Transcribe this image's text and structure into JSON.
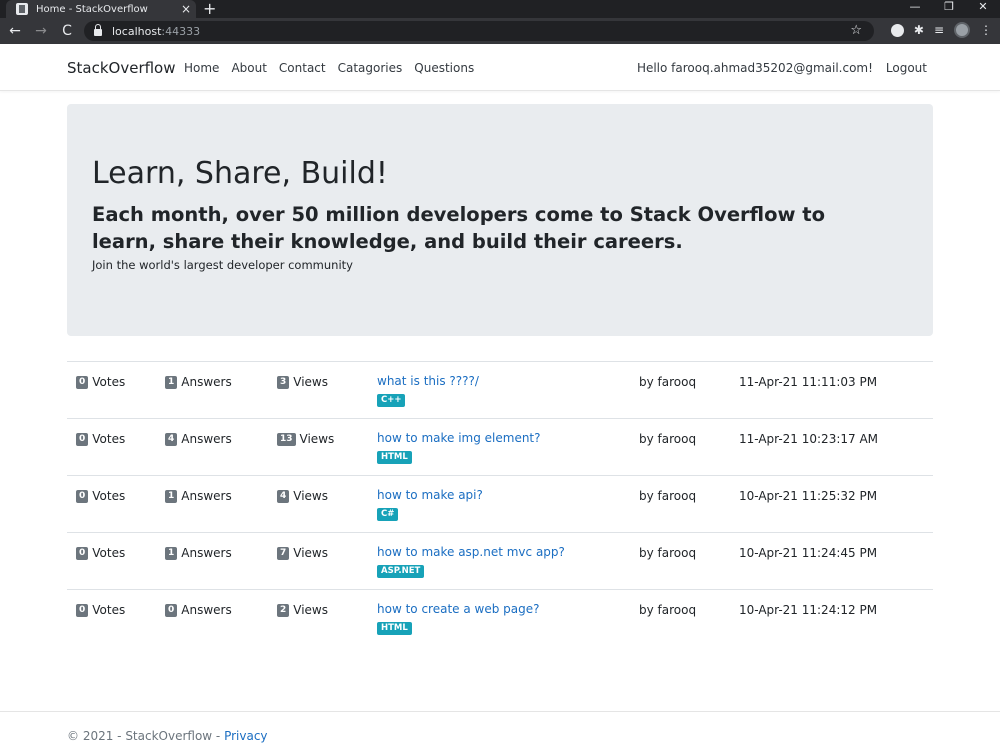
{
  "browser": {
    "tab_title": "Home - StackOverflow",
    "tab_close": "×",
    "new_tab": "+",
    "url_host": "localhost",
    "url_port": ":44333",
    "back": "←",
    "forward": "→",
    "reload": "C"
  },
  "navbar": {
    "brand": "StackOverflow",
    "links": [
      "Home",
      "About",
      "Contact",
      "Catagories",
      "Questions"
    ],
    "greeting": "Hello farooq.ahmad35202@gmail.com!",
    "logout": "Logout"
  },
  "jumbotron": {
    "title": "Learn, Share, Build!",
    "subtitle": "Each month, over 50 million developers come to Stack Overflow to learn, share their knowledge, and build their careers.",
    "tagline": "Join the world's largest developer community"
  },
  "labels": {
    "votes": "Votes",
    "answers": "Answers",
    "views": "Views"
  },
  "questions": [
    {
      "votes": "0",
      "answers": "1",
      "views": "3",
      "title": "what is this ????/",
      "tag": "C++",
      "author": "by farooq",
      "date": "11-Apr-21 11:11:03 PM"
    },
    {
      "votes": "0",
      "answers": "4",
      "views": "13",
      "title": "how to make img element?",
      "tag": "HTML",
      "author": "by farooq",
      "date": "11-Apr-21 10:23:17 AM"
    },
    {
      "votes": "0",
      "answers": "1",
      "views": "4",
      "title": "how to make api?",
      "tag": "C#",
      "author": "by farooq",
      "date": "10-Apr-21 11:25:32 PM"
    },
    {
      "votes": "0",
      "answers": "1",
      "views": "7",
      "title": "how to make asp.net mvc app?",
      "tag": "ASP.NET",
      "author": "by farooq",
      "date": "10-Apr-21 11:24:45 PM"
    },
    {
      "votes": "0",
      "answers": "0",
      "views": "2",
      "title": "how to create a web page?",
      "tag": "HTML",
      "author": "by farooq",
      "date": "10-Apr-21 11:24:12 PM"
    }
  ],
  "footer": {
    "copyright": "© 2021 - StackOverflow - ",
    "privacy": "Privacy"
  },
  "colors": {
    "link": "#1b6ec2",
    "tag": "#17a2b8",
    "badge": "#6c757d",
    "jumbotron": "#e9ecef"
  }
}
